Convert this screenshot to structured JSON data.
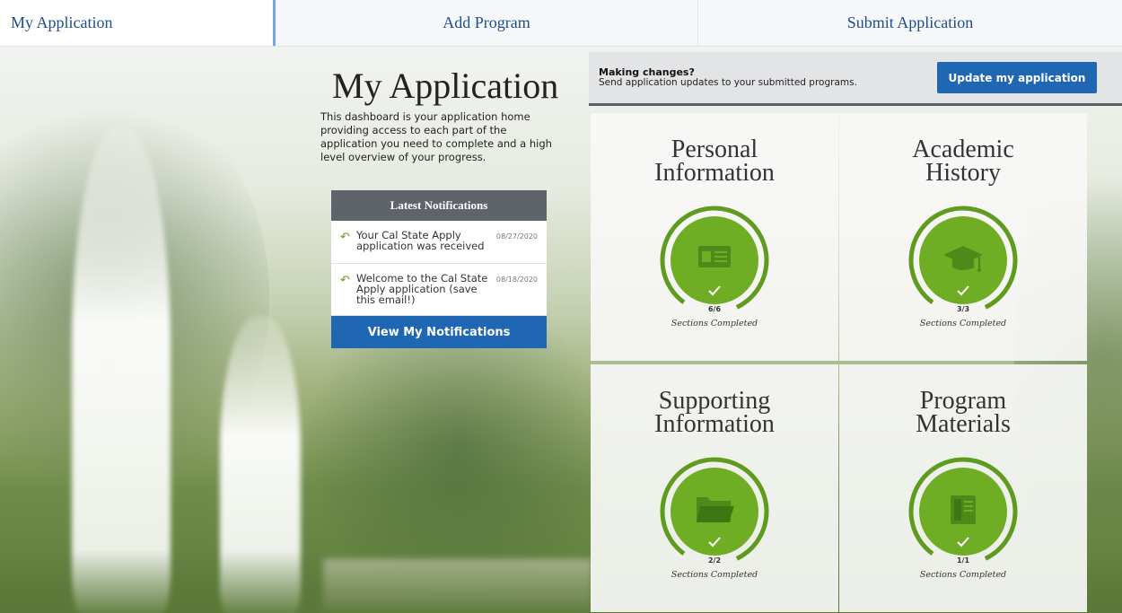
{
  "nav": {
    "tabs": [
      "My Application",
      "Add Program",
      "Submit Application"
    ]
  },
  "intro": {
    "title": "My Application",
    "text": "This dashboard is your application home providing access to each part of the application you need to complete and a high level overview of your progress."
  },
  "notifications": {
    "header": "Latest Notifications",
    "items": [
      {
        "text": "Your Cal State Apply application was received",
        "date": "08/27/2020"
      },
      {
        "text": "Welcome to the Cal State Apply application (save this email!)",
        "date": "08/18/2020"
      }
    ],
    "button": "View My Notifications"
  },
  "update_bar": {
    "heading": "Making changes?",
    "text": "Send application updates to your submitted programs.",
    "button": "Update my application"
  },
  "cards": [
    {
      "title_line1": "Personal",
      "title_line2": "Information",
      "count": "6/6",
      "status": "Sections Completed",
      "completed": 6,
      "total": 6,
      "icon": "id-card-icon"
    },
    {
      "title_line1": "Academic",
      "title_line2": "History",
      "count": "3/3",
      "status": "Sections Completed",
      "completed": 3,
      "total": 3,
      "icon": "graduation-cap-icon"
    },
    {
      "title_line1": "Supporting",
      "title_line2": "Information",
      "count": "2/2",
      "status": "Sections Completed",
      "completed": 2,
      "total": 2,
      "icon": "folder-icon"
    },
    {
      "title_line1": "Program",
      "title_line2": "Materials",
      "count": "1/1",
      "status": "Sections Completed",
      "completed": 1,
      "total": 1,
      "icon": "book-icon"
    }
  ],
  "colors": {
    "accent": "#1f66b3",
    "progress": "#5f9b1f",
    "header_gray": "#5f646b"
  }
}
